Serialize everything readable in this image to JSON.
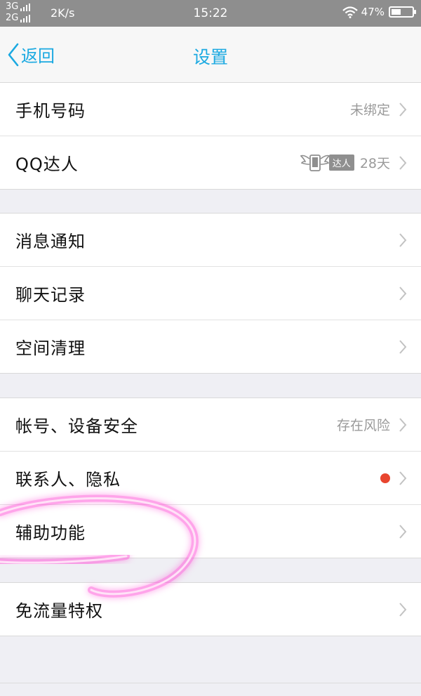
{
  "status_bar": {
    "net1": "3G",
    "net2": "2G",
    "speed": "2K/s",
    "time": "15:22",
    "battery": "47%",
    "battery_level": 0.47
  },
  "nav": {
    "back_label": "返回",
    "title": "设置"
  },
  "groups": [
    {
      "items": [
        {
          "label": "手机号码",
          "value": "未绑定"
        },
        {
          "label": "QQ达人",
          "tag": "达人",
          "value": "28天"
        }
      ]
    },
    {
      "items": [
        {
          "label": "消息通知"
        },
        {
          "label": "聊天记录"
        },
        {
          "label": "空间清理"
        }
      ]
    },
    {
      "items": [
        {
          "label": "帐号、设备安全",
          "value": "存在风险"
        },
        {
          "label": "联系人、隐私"
        },
        {
          "label": "辅助功能"
        }
      ]
    },
    {
      "items": [
        {
          "label": "免流量特权"
        }
      ]
    }
  ],
  "colors": {
    "accent": "#1ba9e1",
    "red_dot": "#e8452f",
    "annotation": "#ff4fd8"
  },
  "icons": {
    "daren": "winged-phone-icon",
    "chevron": "chevron-right-icon",
    "back": "chevron-left-icon"
  }
}
